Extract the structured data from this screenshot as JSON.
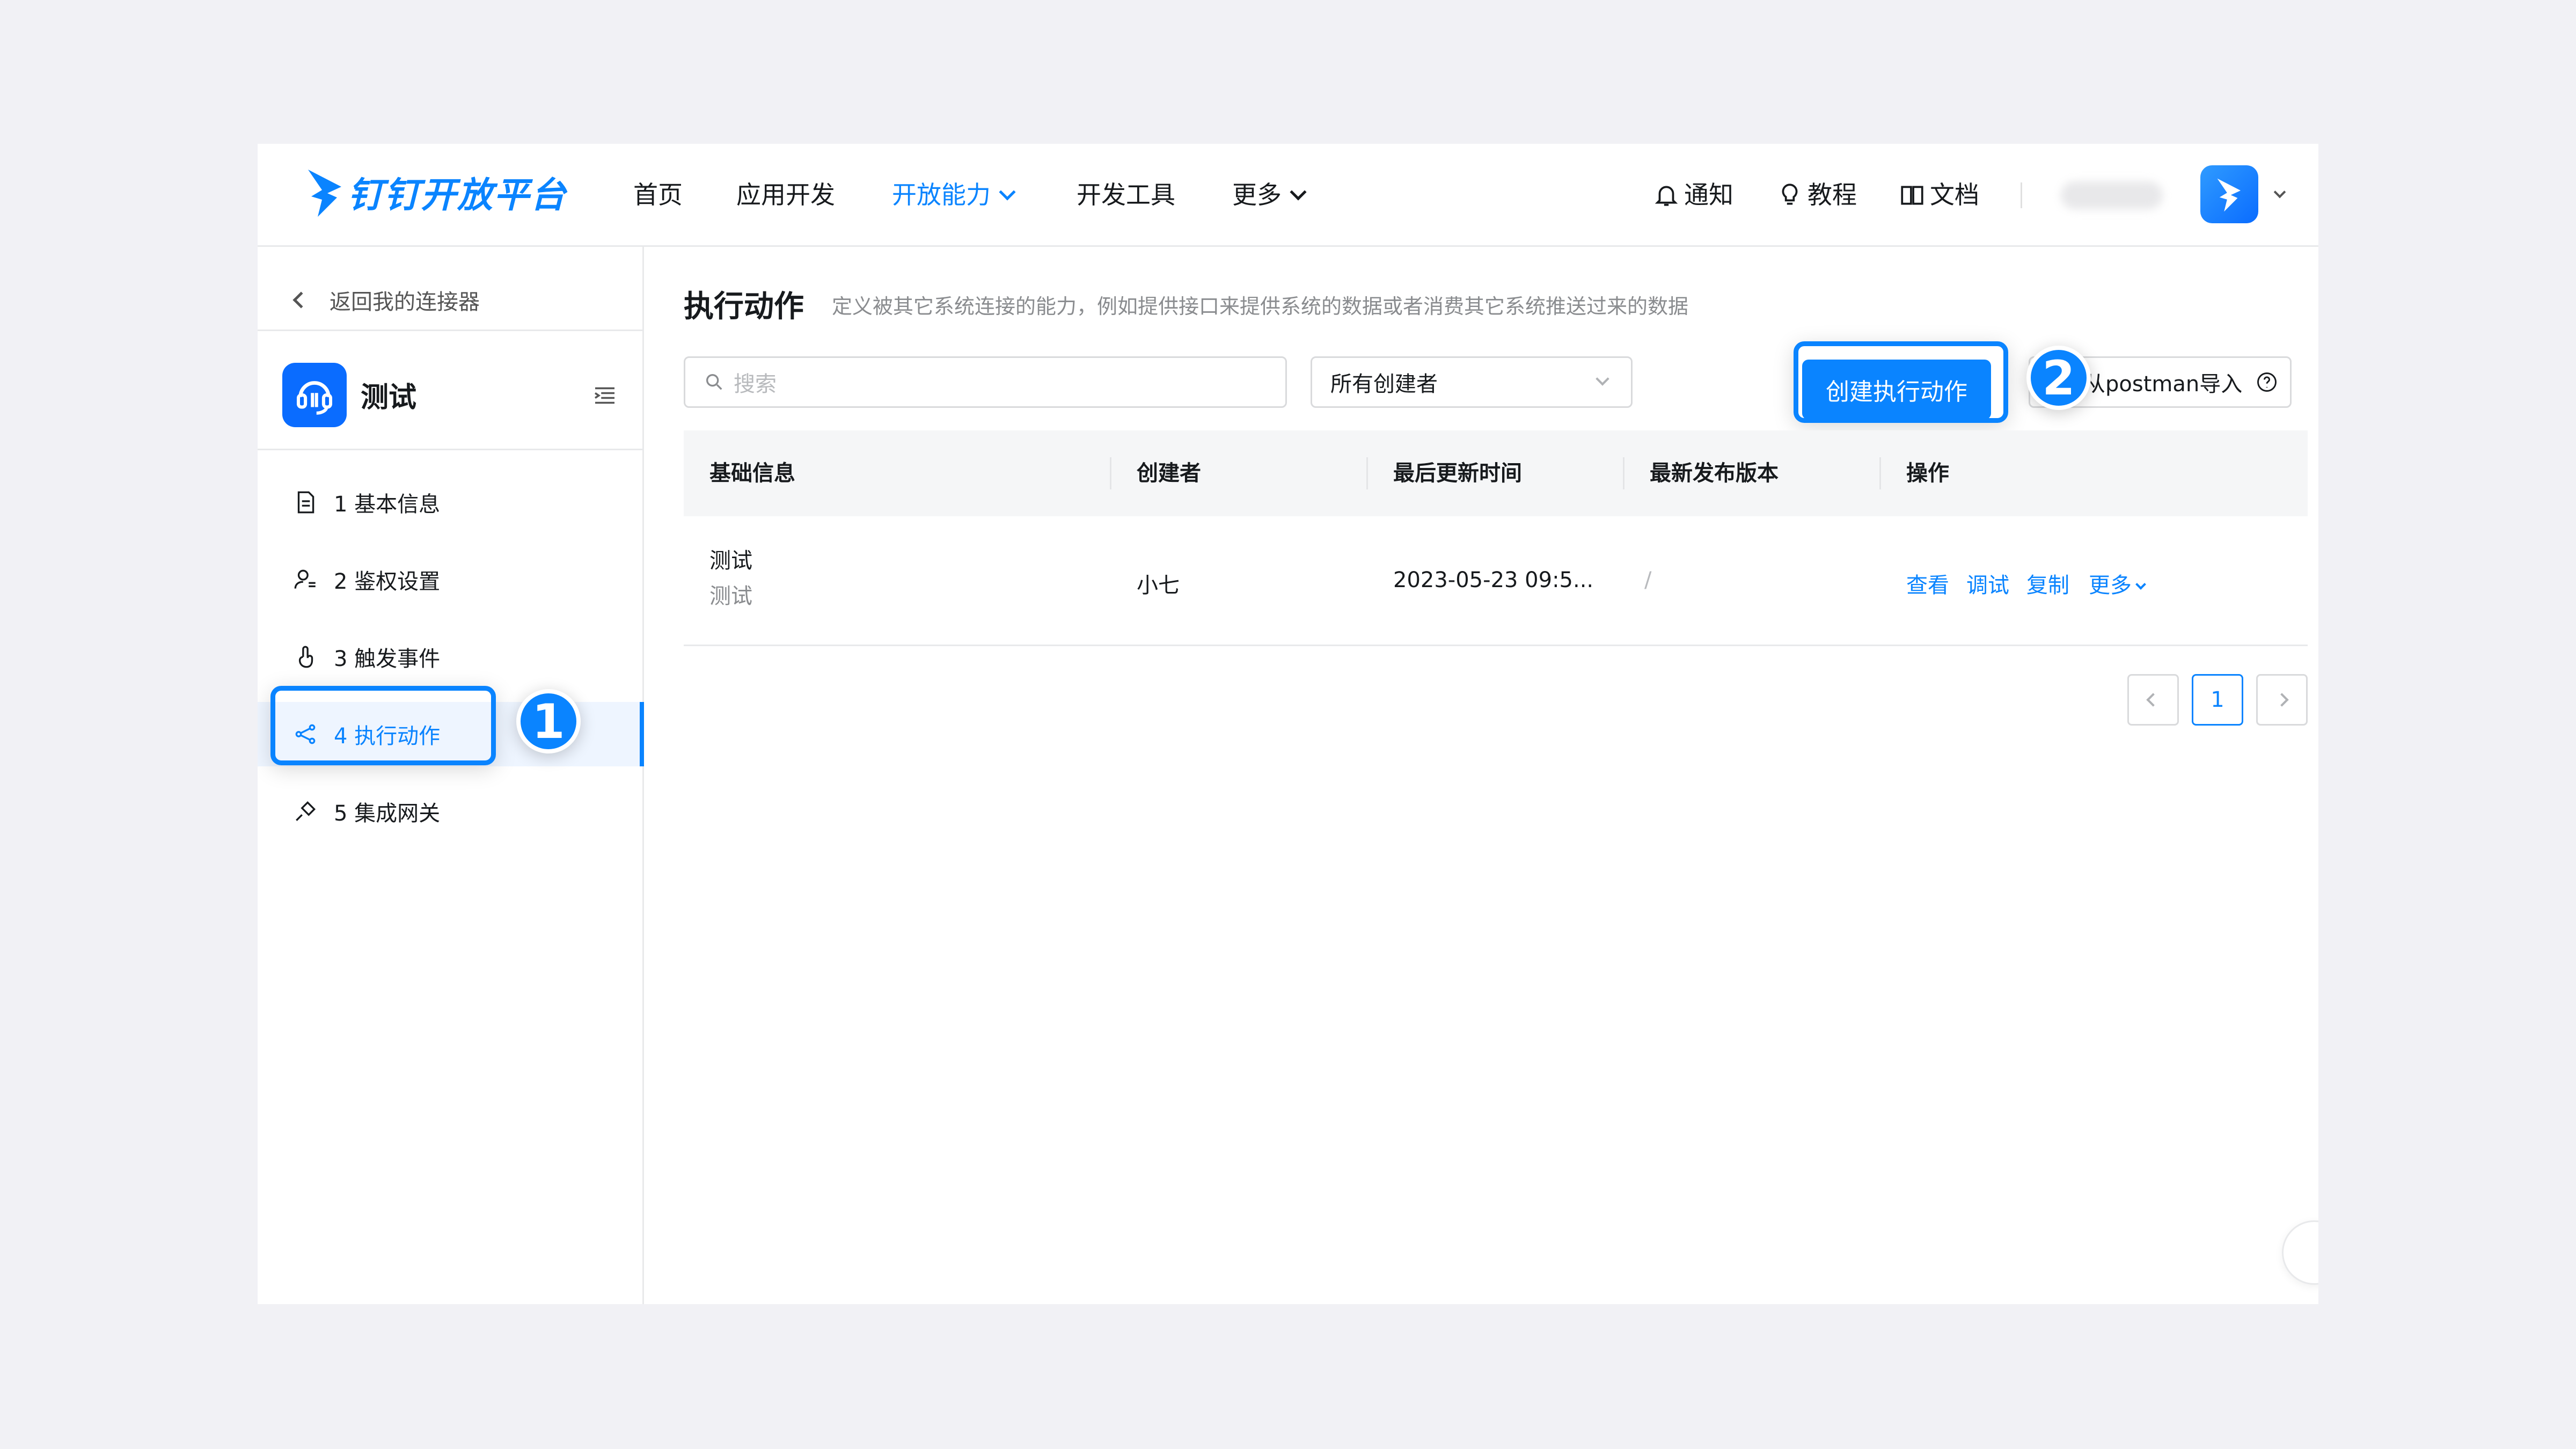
{
  "brand": {
    "name": "钉钉开放平台",
    "color": "#0a84ff"
  },
  "nav": {
    "items": [
      {
        "label": "首页",
        "active": false
      },
      {
        "label": "应用开发",
        "active": false
      },
      {
        "label": "开放能力",
        "active": true,
        "dropdown": true
      },
      {
        "label": "开发工具",
        "active": false
      },
      {
        "label": "更多",
        "active": false,
        "dropdown": true
      }
    ],
    "right": [
      {
        "label": "通知",
        "icon": "bell-icon"
      },
      {
        "label": "教程",
        "icon": "bulb-icon"
      },
      {
        "label": "文档",
        "icon": "book-icon"
      }
    ]
  },
  "sidebar": {
    "back_label": "返回我的连接器",
    "connector_name": "测试",
    "items": [
      {
        "label": "1 基本信息",
        "icon": "document-icon",
        "active": false
      },
      {
        "label": "2 鉴权设置",
        "icon": "user-key-icon",
        "active": false
      },
      {
        "label": "3 触发事件",
        "icon": "touch-icon",
        "active": false
      },
      {
        "label": "4 执行动作",
        "icon": "share-icon",
        "active": true
      },
      {
        "label": "5 集成网关",
        "icon": "plug-icon",
        "active": false
      }
    ]
  },
  "main": {
    "title": "执行动作",
    "description": "定义被其它系统连接的能力，例如提供接口来提供系统的数据或者消费其它系统推送过来的数据",
    "search_placeholder": "搜索",
    "creator_filter": "所有创建者",
    "create_button": "创建执行动作",
    "import_button": "从postman导入"
  },
  "table": {
    "headers": [
      "基础信息",
      "创建者",
      "最后更新时间",
      "最新发布版本",
      "操作"
    ],
    "rows": [
      {
        "name": "测试",
        "desc": "测试",
        "creator": "小七",
        "updated": "2023-05-23 09:5...",
        "version": "/",
        "ops": [
          "查看",
          "调试",
          "复制",
          "更多"
        ]
      }
    ]
  },
  "pagination": {
    "current": "1"
  },
  "annotations": {
    "step1": "1",
    "step2": "2"
  }
}
